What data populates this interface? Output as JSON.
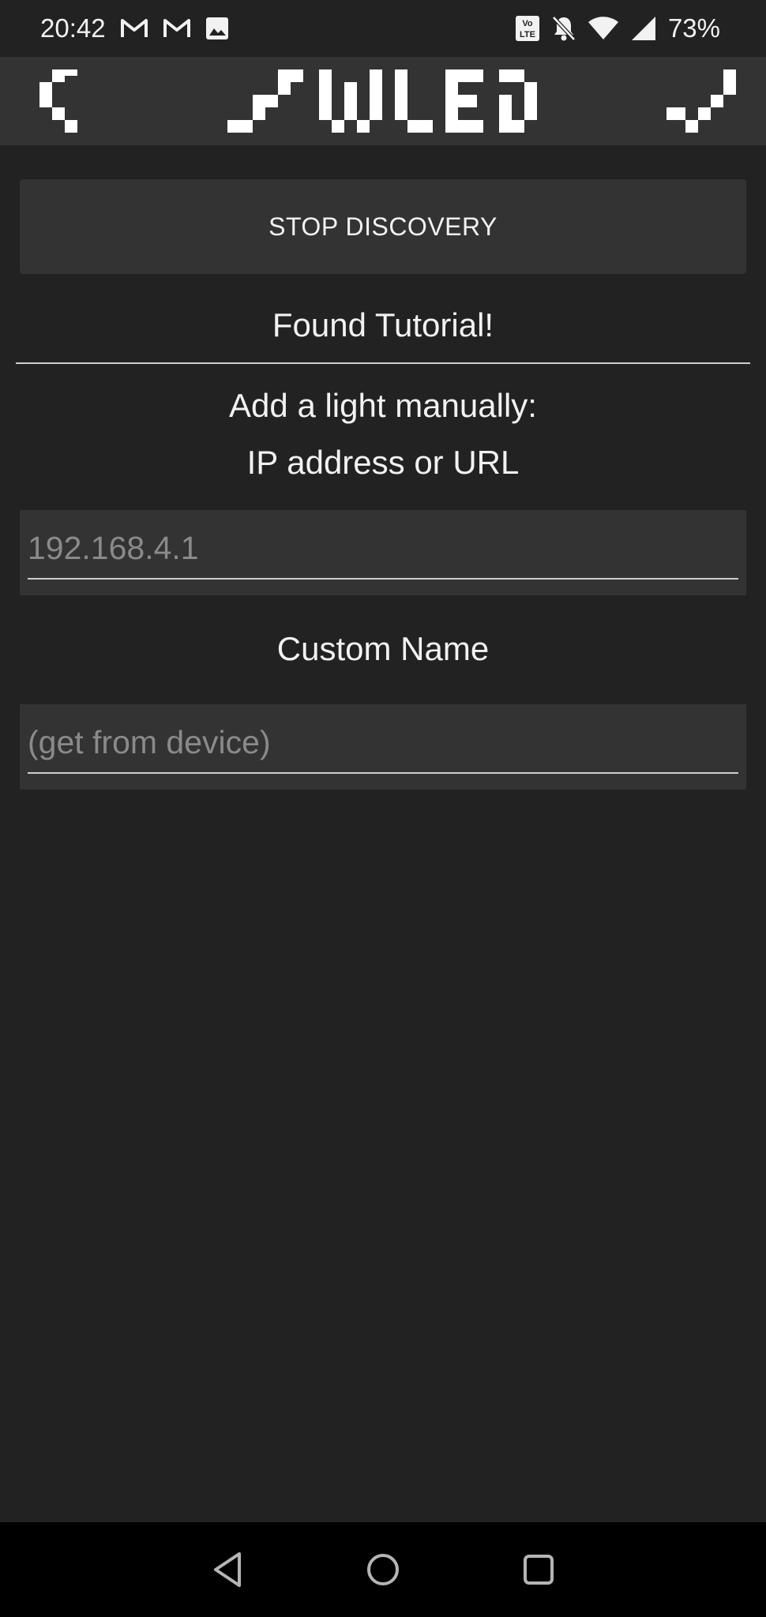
{
  "status_bar": {
    "time": "20:42",
    "battery": "73%",
    "volte_label_top": "Vo",
    "volte_label_bottom": "LTE",
    "icons_left": [
      "gmail-icon",
      "gmail-icon",
      "image-icon"
    ],
    "icons_right": [
      "volte-icon",
      "notifications-off-icon",
      "wifi-icon",
      "cell-signal-icon"
    ]
  },
  "toolbar": {
    "logo_text": "WLED",
    "back_icon": "back-chevron-icon",
    "confirm_icon": "checkmark-icon"
  },
  "main": {
    "stop_discovery_label": "STOP DISCOVERY",
    "found_text": "Found Tutorial!",
    "manual_line1": "Add a light manually:",
    "manual_line2": "IP address or URL",
    "ip_field": {
      "value": "",
      "placeholder": "192.168.4.1"
    },
    "custom_name_label": "Custom Name",
    "name_field": {
      "value": "",
      "placeholder": "(get from device)"
    }
  },
  "nav_bar": {
    "buttons": [
      "back-triangle-icon",
      "home-circle-icon",
      "recents-square-icon"
    ]
  },
  "colors": {
    "background": "#222222",
    "surface": "#333333",
    "text": "#f2f2f2",
    "placeholder": "#8a8a8a",
    "nav_background": "#000000"
  }
}
